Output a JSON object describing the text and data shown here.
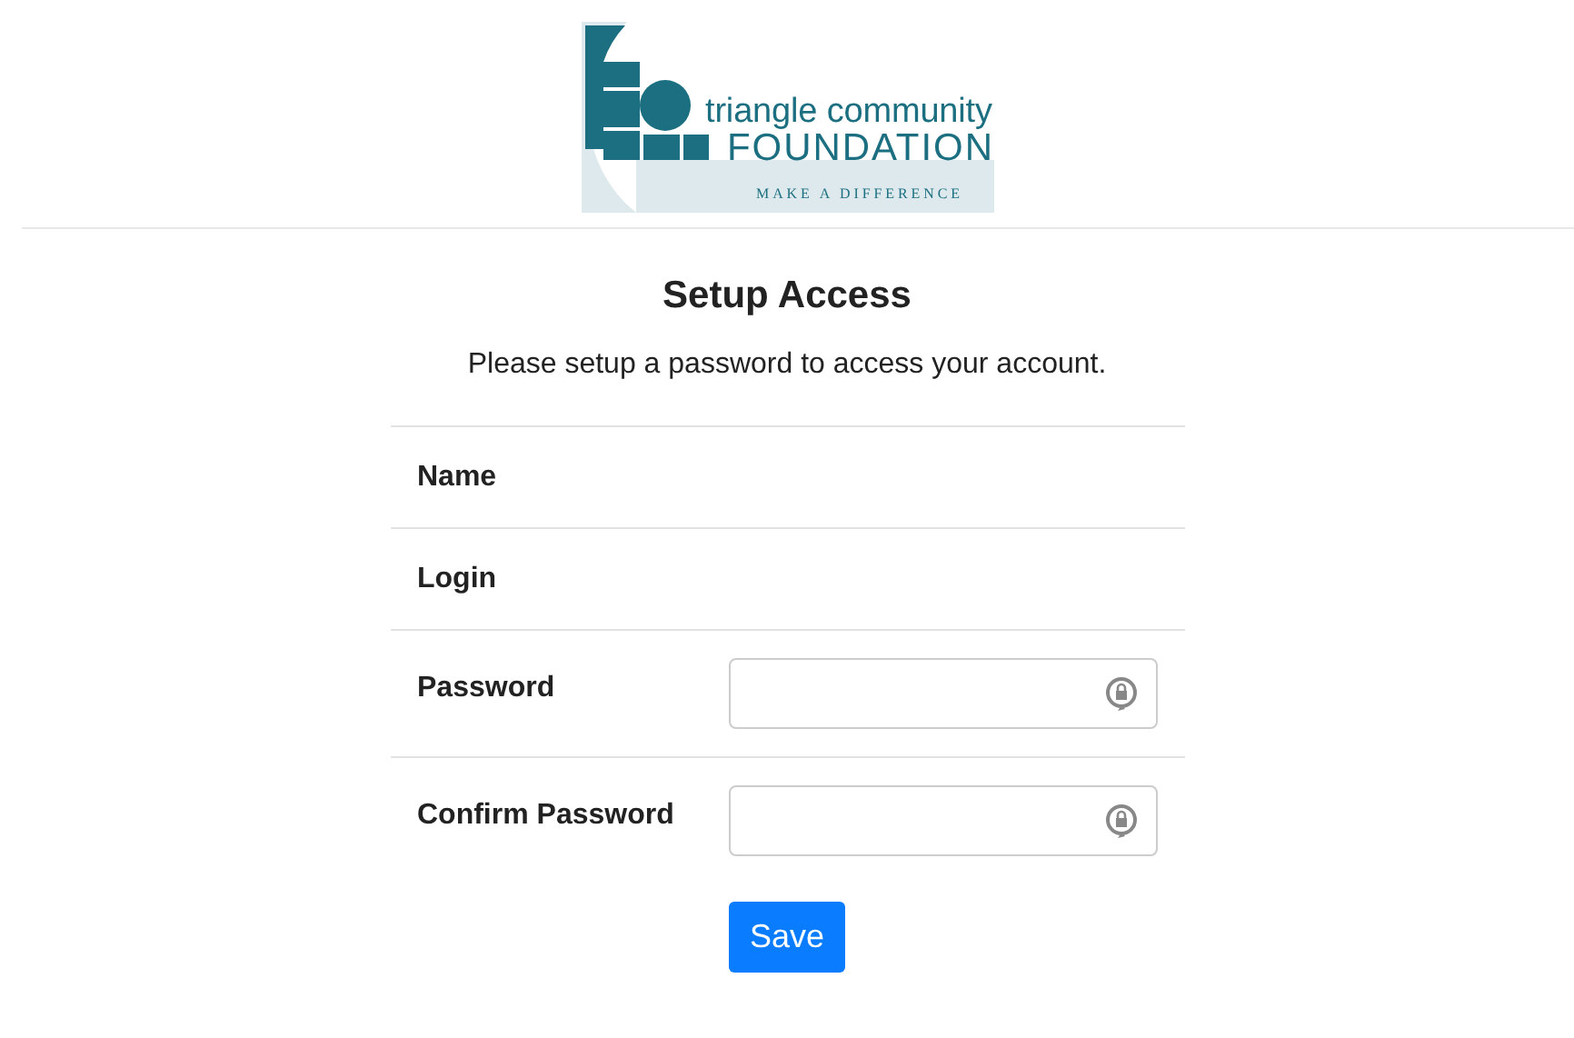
{
  "logo": {
    "line_1": "triangle community",
    "line_2": "FOUNDATION",
    "tagline": "MAKE A DIFFERENCE"
  },
  "title": "Setup Access",
  "subtitle": "Please setup a password to access your account.",
  "fields": [
    {
      "label": "Name",
      "kind": "info"
    },
    {
      "label": "Login",
      "kind": "info"
    },
    {
      "label": "Password",
      "kind": "password"
    },
    {
      "label": "Confirm Password",
      "kind": "password"
    }
  ],
  "save_button": "Save"
}
